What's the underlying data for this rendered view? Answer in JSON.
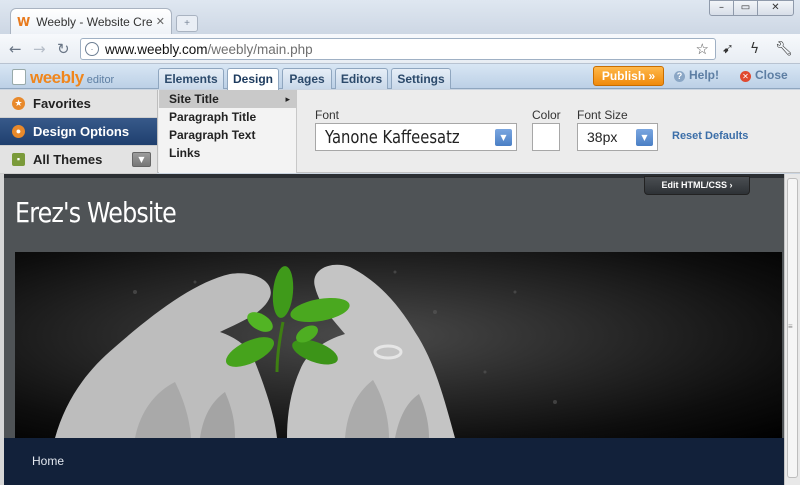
{
  "browser": {
    "tab_title": "Weebly - Website Creation",
    "tab_favicon": "W",
    "url_host": "www.weebly.com",
    "url_path": "/weebly/main.php",
    "nav_icons": [
      "back-arrow-icon",
      "forward-arrow-icon",
      "reload-icon"
    ],
    "toolbar_icons": [
      "star-icon",
      "pin-icon",
      "lightning-icon",
      "wrench-icon"
    ]
  },
  "editor": {
    "logo_text": "weebly",
    "logo_sub": "editor",
    "tabs": [
      {
        "label": "Elements",
        "active": false
      },
      {
        "label": "Design",
        "active": true
      },
      {
        "label": "Pages",
        "active": false
      },
      {
        "label": "Editors",
        "active": false
      },
      {
        "label": "Settings",
        "active": false
      }
    ],
    "publish_label": "Publish »",
    "help_label": "Help!",
    "close_label": "Close"
  },
  "design_panel": {
    "left_nav": [
      {
        "label": "Favorites",
        "active": false
      },
      {
        "label": "Design Options",
        "active": true
      },
      {
        "label": "All Themes",
        "active": false
      }
    ],
    "sub_items": [
      {
        "label": "Site Title",
        "active": true
      },
      {
        "label": "Paragraph Title",
        "active": false
      },
      {
        "label": "Paragraph Text",
        "active": false
      },
      {
        "label": "Links",
        "active": false
      }
    ],
    "font_label": "Font",
    "font_value": "Yanone Kaffeesatz",
    "color_label": "Color",
    "color_value": "#ffffff",
    "size_label": "Font Size",
    "size_value": "38px",
    "reset_label": "Reset Defaults"
  },
  "site": {
    "edit_html_label": "Edit HTML/CSS ›",
    "title": "Erez's Website",
    "nav_items": [
      "Home"
    ]
  },
  "colors": {
    "accent_orange": "#f08a0c",
    "active_nav": "#1f3f6e",
    "site_nav": "#12213a"
  }
}
